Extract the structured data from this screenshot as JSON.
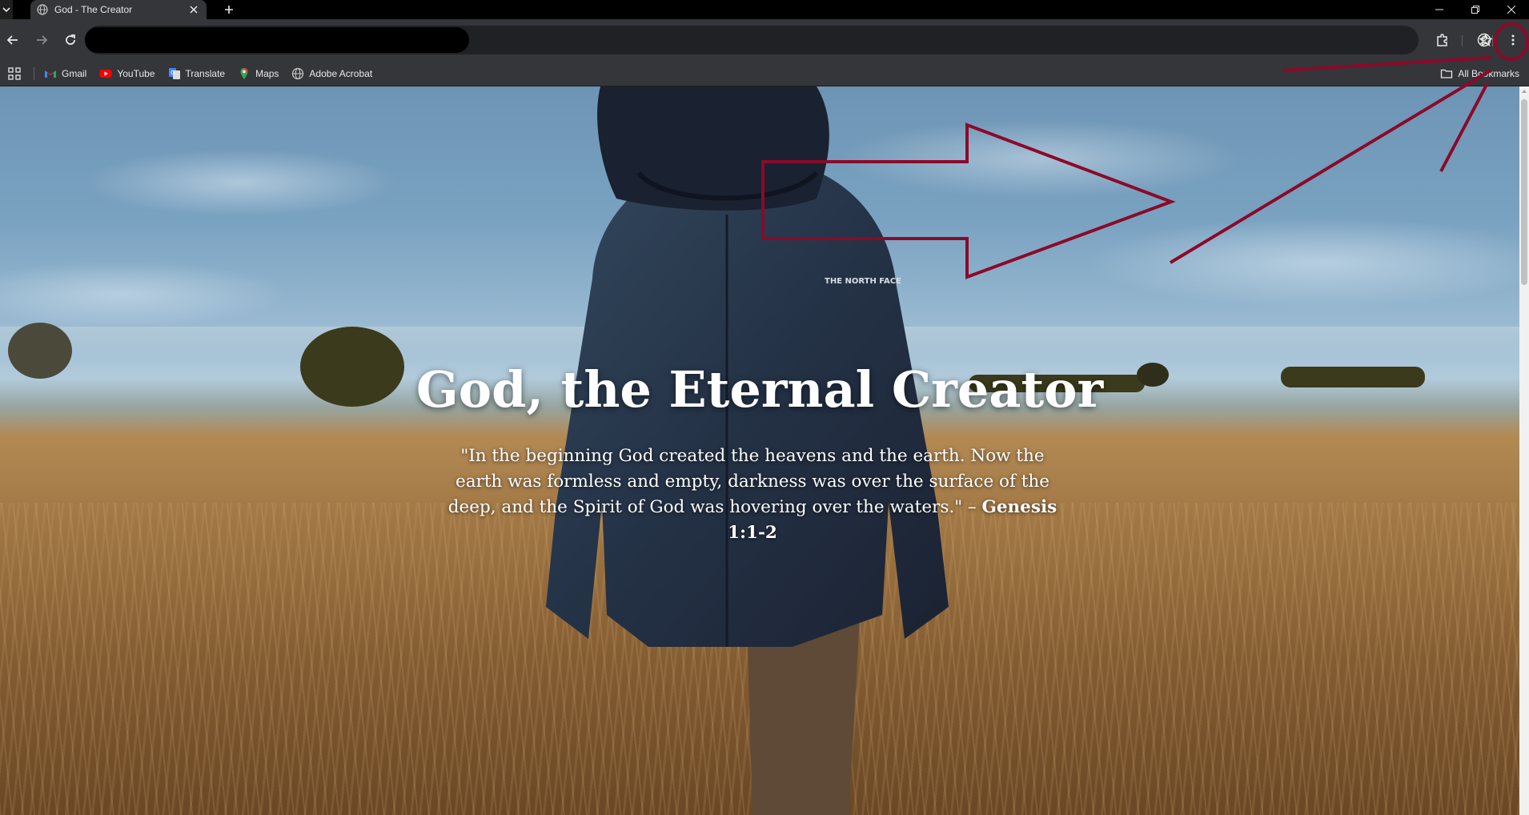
{
  "browser": {
    "tab": {
      "title": "God - The Creator",
      "favicon": "globe-icon"
    },
    "bookmarks": [
      {
        "label": "Gmail",
        "icon": "gmail-icon"
      },
      {
        "label": "YouTube",
        "icon": "youtube-icon"
      },
      {
        "label": "Translate",
        "icon": "translate-icon"
      },
      {
        "label": "Maps",
        "icon": "maps-icon"
      },
      {
        "label": "Adobe Acrobat",
        "icon": "globe-icon"
      }
    ],
    "all_bookmarks_label": "All Bookmarks",
    "theme_colors": {
      "frame": "#000000",
      "toolbar": "#35363a",
      "omnibox": "#202124",
      "text": "#e8e8e8"
    }
  },
  "page": {
    "hero_title": "God, the Eternal Creator",
    "quote_text": "\"In the beginning God created the heavens and the earth. Now the earth was formless and empty, darkness was over the surface of the deep, and the Spirit of God was hovering over the waters.\" – ",
    "quote_reference": "Genesis 1:1-2",
    "jacket_logo": "THE NORTH FACE"
  },
  "annotations": {
    "color": "#8b0a2a",
    "description_marks": [
      "arrow-outline",
      "pointer-line",
      "menu-circle"
    ]
  }
}
